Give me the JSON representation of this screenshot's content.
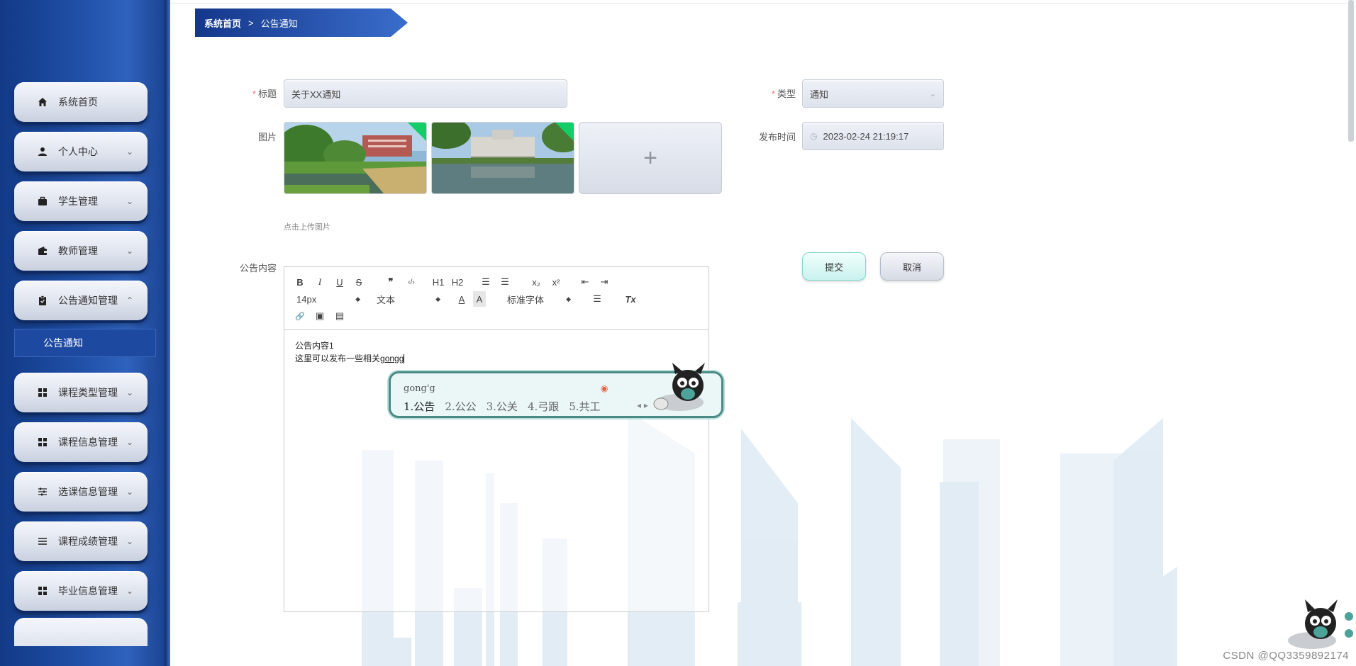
{
  "sidebar": {
    "items": [
      {
        "label": "系统首页",
        "icon": "home-icon",
        "chevron": ""
      },
      {
        "label": "个人中心",
        "icon": "user-icon",
        "chevron": "⌄"
      },
      {
        "label": "学生管理",
        "icon": "briefcase-icon",
        "chevron": "⌄"
      },
      {
        "label": "教师管理",
        "icon": "wallet-icon",
        "chevron": "⌄"
      },
      {
        "label": "公告通知管理",
        "icon": "clipboard-icon",
        "chevron": "⌃"
      },
      {
        "label": "课程类型管理",
        "icon": "grid-icon",
        "chevron": "⌄"
      },
      {
        "label": "课程信息管理",
        "icon": "grid-icon",
        "chevron": "⌄"
      },
      {
        "label": "选课信息管理",
        "icon": "sliders-icon",
        "chevron": "⌄"
      },
      {
        "label": "课程成绩管理",
        "icon": "list-icon",
        "chevron": "⌄"
      },
      {
        "label": "毕业信息管理",
        "icon": "grid-icon",
        "chevron": "⌄"
      }
    ],
    "active_sub": "公告通知"
  },
  "breadcrumb": {
    "home": "系统首页",
    "separator": ">",
    "current": "公告通知"
  },
  "form": {
    "title_label": "标题",
    "title_value": "关于XX通知",
    "type_label": "类型",
    "type_value": "通知",
    "image_label": "图片",
    "publish_time_label": "发布时间",
    "publish_time_value": "2023-02-24 21:19:17",
    "upload_hint": "点击上传图片",
    "upload_plus": "+",
    "content_label": "公告内容",
    "required_mark": "*"
  },
  "editor": {
    "toolbar": {
      "bold": "B",
      "italic": "I",
      "underline": "U",
      "strike": "S",
      "quote": "❞",
      "code": "‹/›",
      "h1": "H1",
      "h2": "H2",
      "ordered_list": "☰",
      "bullet_list": "☰",
      "subscript": "x₂",
      "superscript": "x²",
      "outdent": "⇤",
      "indent": "⇥",
      "size": "14px",
      "header": "文本",
      "font": "标准字体",
      "color": "A",
      "background": "A",
      "align": "☰",
      "clean": "Tx",
      "link": "🔗",
      "image": "▣",
      "video": "▤"
    },
    "content_line1": "公告内容1",
    "content_line2_prefix": "这里可以发布一些相关",
    "content_line2_composing": "gongg"
  },
  "ime": {
    "composition": "gong'g",
    "candidates": [
      "1.公告",
      "2.公公",
      "3.公关",
      "4.弓跟",
      "5.共工"
    ],
    "arrows": "◂ ▸"
  },
  "buttons": {
    "submit": "提交",
    "cancel": "取消"
  },
  "watermark": "CSDN @QQ3359892174",
  "colors": {
    "sidebar_bg": "#1f4fa6",
    "breadcrumb_bg": "#14378a",
    "required": "#f56c6c",
    "submit_border": "#7fd8cf",
    "upload_badge": "#13ce66"
  }
}
